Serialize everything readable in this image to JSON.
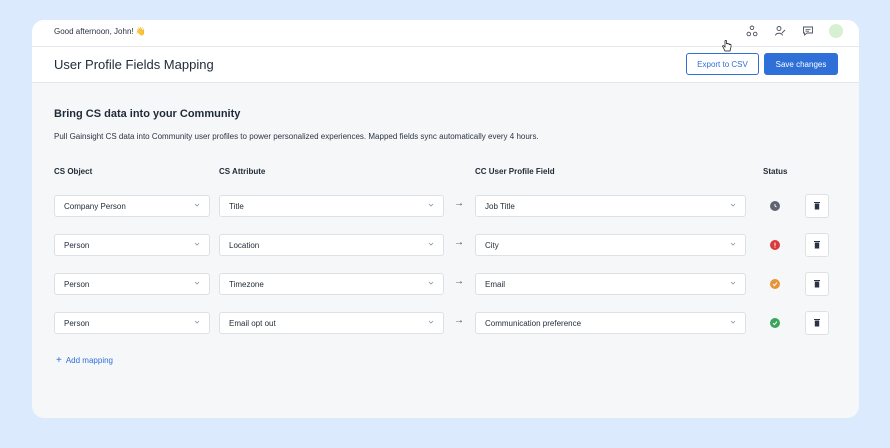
{
  "topbar": {
    "greeting": "Good afternoon, John! 👋"
  },
  "header": {
    "title": "User Profile Fields Mapping",
    "export_label": "Export to CSV",
    "save_label": "Save changes"
  },
  "section": {
    "title": "Bring CS data into your Community",
    "description": "Pull Gainsight CS data into Community user profiles to power personalized experiences. Mapped fields sync automatically every 4 hours."
  },
  "columns": {
    "object": "CS Object",
    "attribute": "CS Attribute",
    "field": "CC User Profile Field",
    "status": "Status"
  },
  "rows": [
    {
      "object": "Company Person",
      "attribute": "Title",
      "field": "Job Title",
      "status": "pending",
      "status_color": "#5f6570"
    },
    {
      "object": "Person",
      "attribute": "Location",
      "field": "City",
      "status": "error",
      "status_color": "#d93b3b"
    },
    {
      "object": "Person",
      "attribute": "Timezone",
      "field": "Email",
      "status": "warning",
      "status_color": "#e8953a"
    },
    {
      "object": "Person",
      "attribute": "Email opt out",
      "field": "Communication preference",
      "status": "success",
      "status_color": "#3aa55b"
    }
  ],
  "add_mapping": "Add mapping",
  "colors": {
    "accent": "#2f6fd8",
    "background": "#dbeafc"
  }
}
